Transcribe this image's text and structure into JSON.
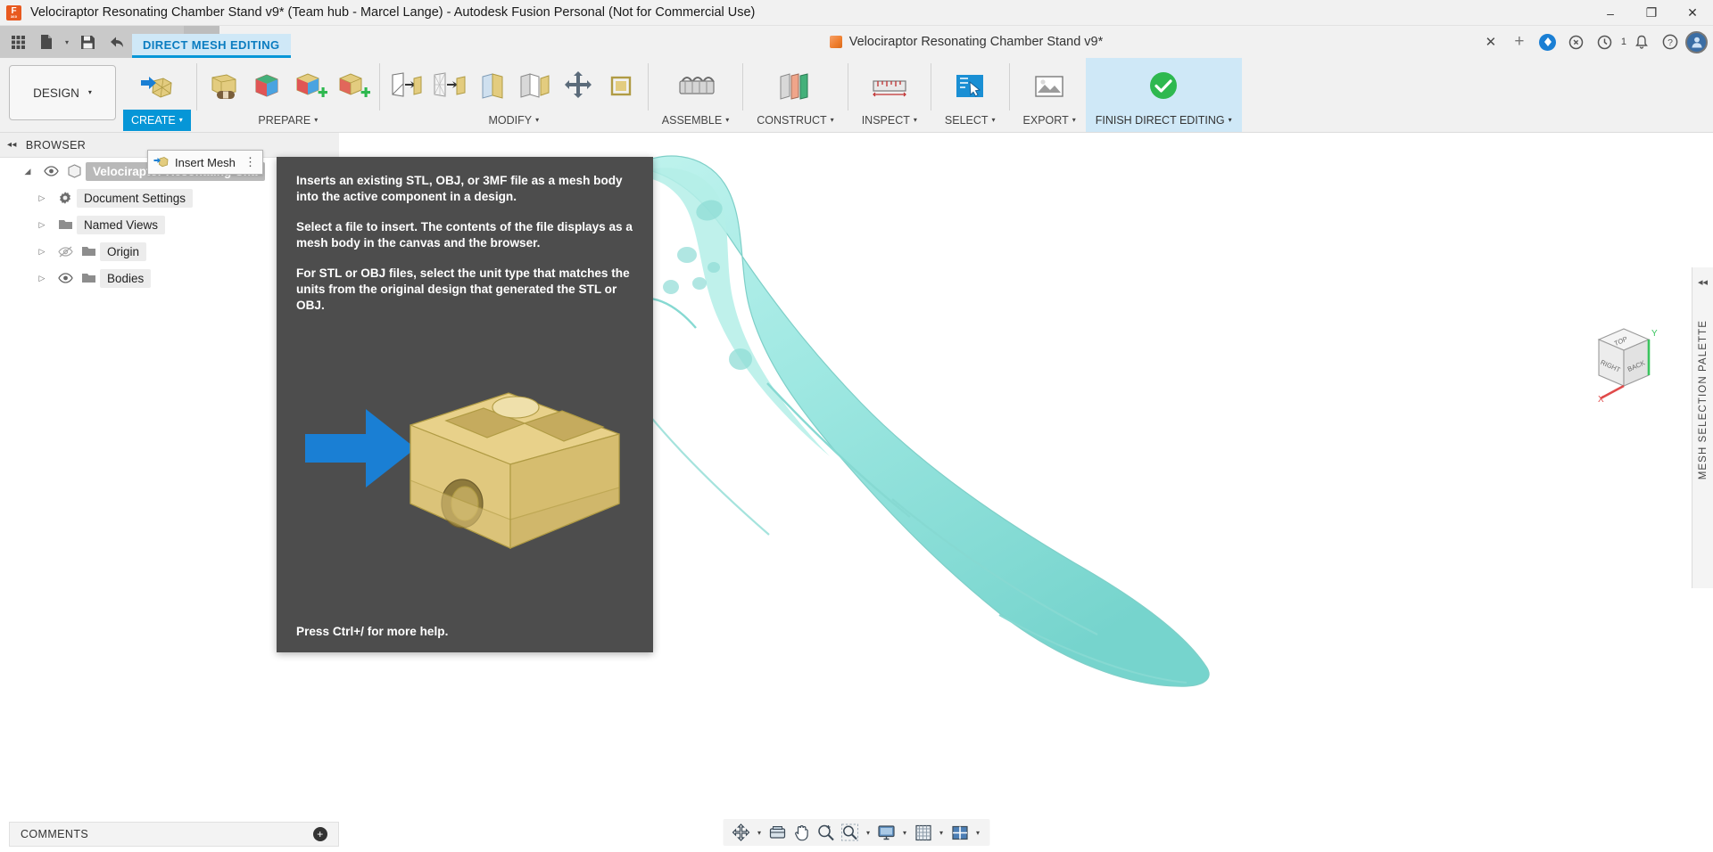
{
  "titlebar": {
    "title": "Velociraptor Resonating Chamber Stand v9* (Team hub - Marcel Lange) - Autodesk Fusion Personal (Not for Commercial Use)",
    "app_icon": "fusion-logo-icon",
    "minimize": "–",
    "maximize": "❐",
    "close": "✕"
  },
  "quick_access": {
    "grid_label": "show-data-panel",
    "new_label": "new-file",
    "save_label": "save",
    "undo_label": "undo",
    "redo_label": "redo",
    "home_label": "home"
  },
  "doc_tab": {
    "label": "Velociraptor Resonating Chamber Stand v9*",
    "close": "✕",
    "add": "+",
    "notification_count": "1"
  },
  "workspace": {
    "label": "DESIGN",
    "caret": "▾"
  },
  "ribbon": {
    "active_tab": "DIRECT MESH EDITING",
    "panels": [
      {
        "label": "CREATE",
        "caret": "▾",
        "active": true
      },
      {
        "label": "PREPARE",
        "caret": "▾",
        "active": false
      },
      {
        "label": "MODIFY",
        "caret": "▾",
        "active": false
      },
      {
        "label": "ASSEMBLE",
        "caret": "▾",
        "active": false
      },
      {
        "label": "CONSTRUCT",
        "caret": "▾",
        "active": false
      },
      {
        "label": "INSPECT",
        "caret": "▾",
        "active": false
      },
      {
        "label": "SELECT",
        "caret": "▾",
        "active": false
      },
      {
        "label": "EXPORT",
        "caret": "▾",
        "active": false
      },
      {
        "label": "FINISH DIRECT EDITING",
        "caret": "▾",
        "active": false
      }
    ]
  },
  "flyout": {
    "label": "Insert Mesh",
    "overflow": "⋮"
  },
  "tooltip": {
    "paragraphs": [
      "Inserts an existing STL, OBJ, or 3MF file as a mesh body into the active component in a design.",
      "Select a file to insert. The contents of the file displays as a mesh body in the canvas and the browser.",
      "For STL or OBJ files, select the unit type that matches the units from the original design that generated the STL or OBJ."
    ],
    "footer": "Press Ctrl+/ for more help."
  },
  "browser": {
    "header": "BROWSER",
    "collapse": "◂◂",
    "root": {
      "label": "Velociraptor Resonating Cha",
      "arrow": "◢"
    },
    "items": [
      {
        "label": "Document Settings",
        "icon": "gear-icon",
        "arrow": "▷",
        "eye": false,
        "eye_hidden": false
      },
      {
        "label": "Named Views",
        "icon": "folder-icon",
        "arrow": "▷",
        "eye": false,
        "eye_hidden": false
      },
      {
        "label": "Origin",
        "icon": "folder-icon",
        "arrow": "▷",
        "eye": true,
        "eye_hidden": true
      },
      {
        "label": "Bodies",
        "icon": "folder-icon",
        "arrow": "▷",
        "eye": true,
        "eye_hidden": false
      }
    ]
  },
  "right_palette": {
    "label": "MESH SELECTION PALETTE",
    "collapse": "◂◂"
  },
  "viewcube": {
    "top_face": "TOP",
    "left_face": "RIGHT",
    "right_face": "BACK",
    "axis_x": "X",
    "axis_y": "Y"
  },
  "comments": {
    "label": "COMMENTS",
    "add": "+"
  },
  "navbar": {
    "items": [
      {
        "name": "orbit-icon",
        "caret": true
      },
      {
        "name": "look-at-icon",
        "caret": false
      },
      {
        "name": "pan-icon",
        "caret": false
      },
      {
        "name": "zoom-icon",
        "caret": false
      },
      {
        "name": "zoom-window-icon",
        "caret": true
      },
      {
        "name": "display-settings-icon",
        "caret": true
      },
      {
        "name": "grid-snap-icon",
        "caret": true
      },
      {
        "name": "viewports-icon",
        "caret": true
      }
    ]
  },
  "colors": {
    "accent": "#0696d7",
    "tab_highlight": "#cfe8f7",
    "model_cyan": "#9fe8e2",
    "tooltip_bg": "#4d4d4d",
    "mesh_gold": "#e0c878"
  }
}
